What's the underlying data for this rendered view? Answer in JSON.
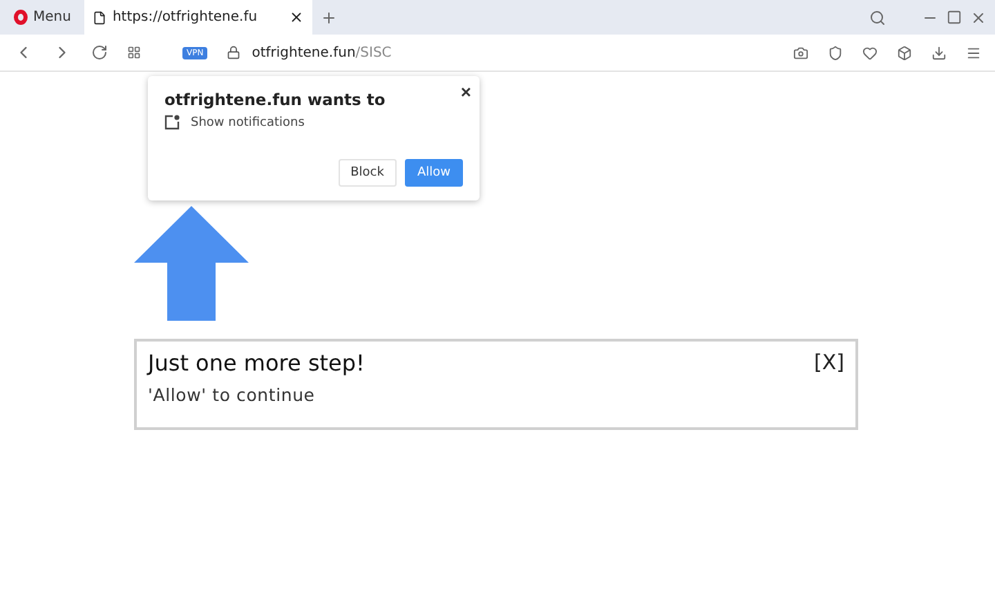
{
  "browser": {
    "menu_label": "Menu",
    "tabs": [
      {
        "title": "https://otfrightene.fu",
        "selected": true
      }
    ],
    "address": {
      "vpn_badge": "VPN",
      "domain": "otfrightene.fun",
      "path": "/SISC"
    }
  },
  "permission_popup": {
    "title": "otfrightene.fun wants to",
    "permission": "Show notifications",
    "close": "×",
    "buttons": [
      {
        "label": "Block",
        "kind": "secondary"
      },
      {
        "label": "Allow",
        "kind": "primary"
      }
    ]
  },
  "notice": {
    "title": "Just one more step!",
    "message": "'Allow' to continue",
    "close": "[X]"
  }
}
